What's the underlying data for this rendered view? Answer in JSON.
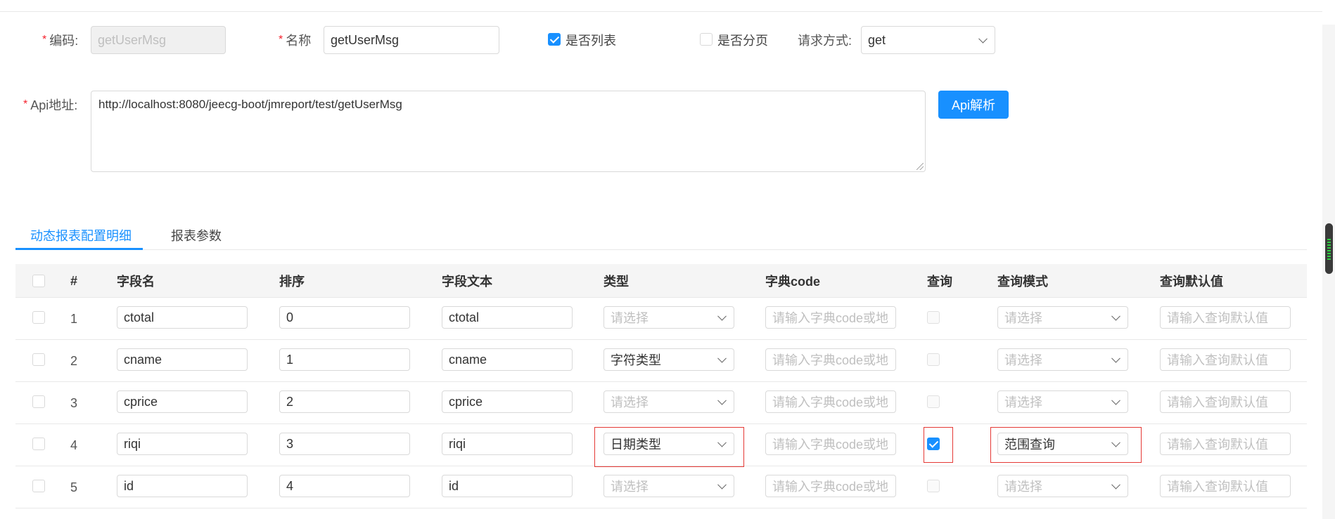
{
  "form": {
    "code_label": "编码:",
    "code_value": "getUserMsg",
    "name_label": "名称",
    "name_value": "getUserMsg",
    "is_list_label": "是否列表",
    "is_page_label": "是否分页",
    "method_label": "请求方式:",
    "method_value": "get",
    "api_label": "Api地址:",
    "api_value": "http://localhost:8080/jeecg-boot/jmreport/test/getUserMsg",
    "parse_button": "Api解析",
    "required_mark": "*"
  },
  "tabs": [
    {
      "label": "动态报表配置明细",
      "active": true
    },
    {
      "label": "报表参数",
      "active": false
    }
  ],
  "table": {
    "headers": [
      "#",
      "字段名",
      "排序",
      "字段文本",
      "类型",
      "字典code",
      "查询",
      "查询模式",
      "查询默认值"
    ],
    "placeholders": {
      "select": "请选择",
      "dict": "请输入字典code或地",
      "default": "请输入查询默认值"
    },
    "rows": [
      {
        "num": "1",
        "field": "ctotal",
        "order": "0",
        "text": "ctotal",
        "type": "",
        "query": false,
        "mode": ""
      },
      {
        "num": "2",
        "field": "cname",
        "order": "1",
        "text": "cname",
        "type": "字符类型",
        "query": false,
        "mode": ""
      },
      {
        "num": "3",
        "field": "cprice",
        "order": "2",
        "text": "cprice",
        "type": "",
        "query": false,
        "mode": ""
      },
      {
        "num": "4",
        "field": "riqi",
        "order": "3",
        "text": "riqi",
        "type": "日期类型",
        "query": true,
        "mode": "范围查询"
      },
      {
        "num": "5",
        "field": "id",
        "order": "4",
        "text": "id",
        "type": "",
        "query": false,
        "mode": ""
      }
    ]
  },
  "colors": {
    "primary": "#1890ff",
    "highlight": "#e53935"
  }
}
